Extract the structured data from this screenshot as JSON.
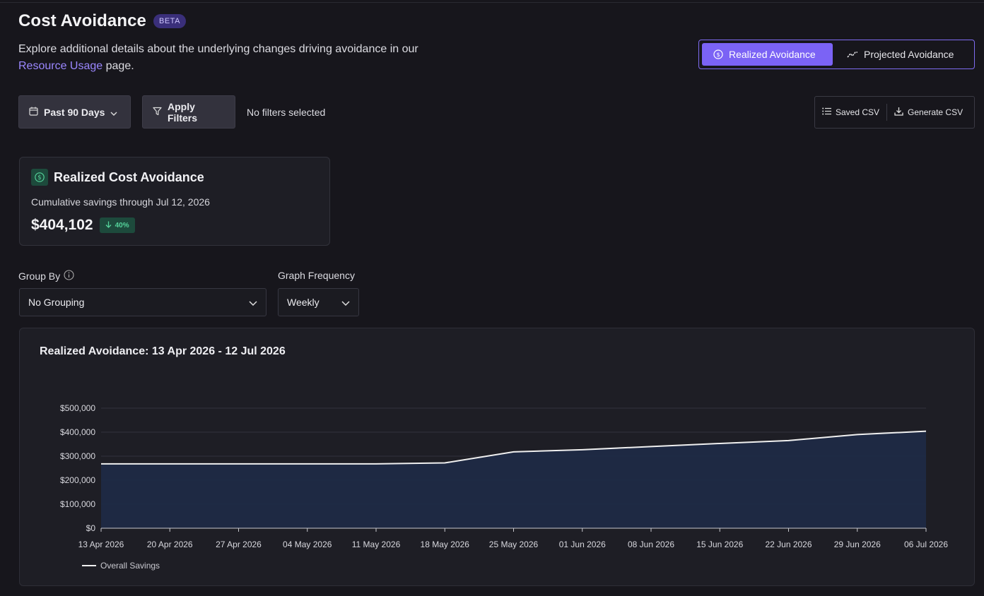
{
  "header": {
    "title": "Cost Avoidance",
    "badge": "BETA",
    "subtitle_text": "Explore additional details about the underlying changes driving avoidance in our",
    "subtitle_link": "Resource Usage",
    "subtitle_tail": "page."
  },
  "mode_toggle": {
    "realized_label": "Realized Avoidance",
    "projected_label": "Projected Avoidance",
    "active": "realized"
  },
  "filters": {
    "date_range": "Past 90 Days",
    "apply_label": "Apply Filters",
    "status": "No filters selected"
  },
  "csv": {
    "saved_label": "Saved CSV",
    "generate_label": "Generate CSV"
  },
  "kpi": {
    "title": "Realized Cost Avoidance",
    "subtitle": "Cumulative savings through Jul 12, 2026",
    "value": "$404,102",
    "delta": "40%",
    "delta_direction": "down"
  },
  "controls": {
    "group_by_label": "Group By",
    "group_by_value": "No Grouping",
    "frequency_label": "Graph Frequency",
    "frequency_value": "Weekly"
  },
  "colors": {
    "accent": "#7b63f5",
    "positive": "#55d39b",
    "area_fill": "#1f2a44",
    "line": "#f0f0f0"
  },
  "chart_data": {
    "type": "area",
    "title": "Realized Avoidance: 13 Apr 2026 - 12 Jul 2026",
    "xlabel": "",
    "ylabel": "",
    "x": [
      "13 Apr 2026",
      "20 Apr 2026",
      "27 Apr 2026",
      "04 May 2026",
      "11 May 2026",
      "18 May 2026",
      "25 May 2026",
      "01 Jun 2026",
      "08 Jun 2026",
      "15 Jun 2026",
      "22 Jun 2026",
      "29 Jun 2026",
      "06 Jul 2026"
    ],
    "series": [
      {
        "name": "Overall Savings",
        "values": [
          268000,
          268000,
          268000,
          268000,
          268000,
          272000,
          318000,
          327000,
          340000,
          353000,
          365000,
          390000,
          404000
        ]
      }
    ],
    "y_ticks": [
      "$0",
      "$100,000",
      "$200,000",
      "$300,000",
      "$400,000",
      "$500,000"
    ],
    "y_tick_values": [
      0,
      100000,
      200000,
      300000,
      400000,
      500000
    ],
    "ylim": [
      0,
      500000
    ],
    "grid": true,
    "legend": "bottom-left"
  }
}
